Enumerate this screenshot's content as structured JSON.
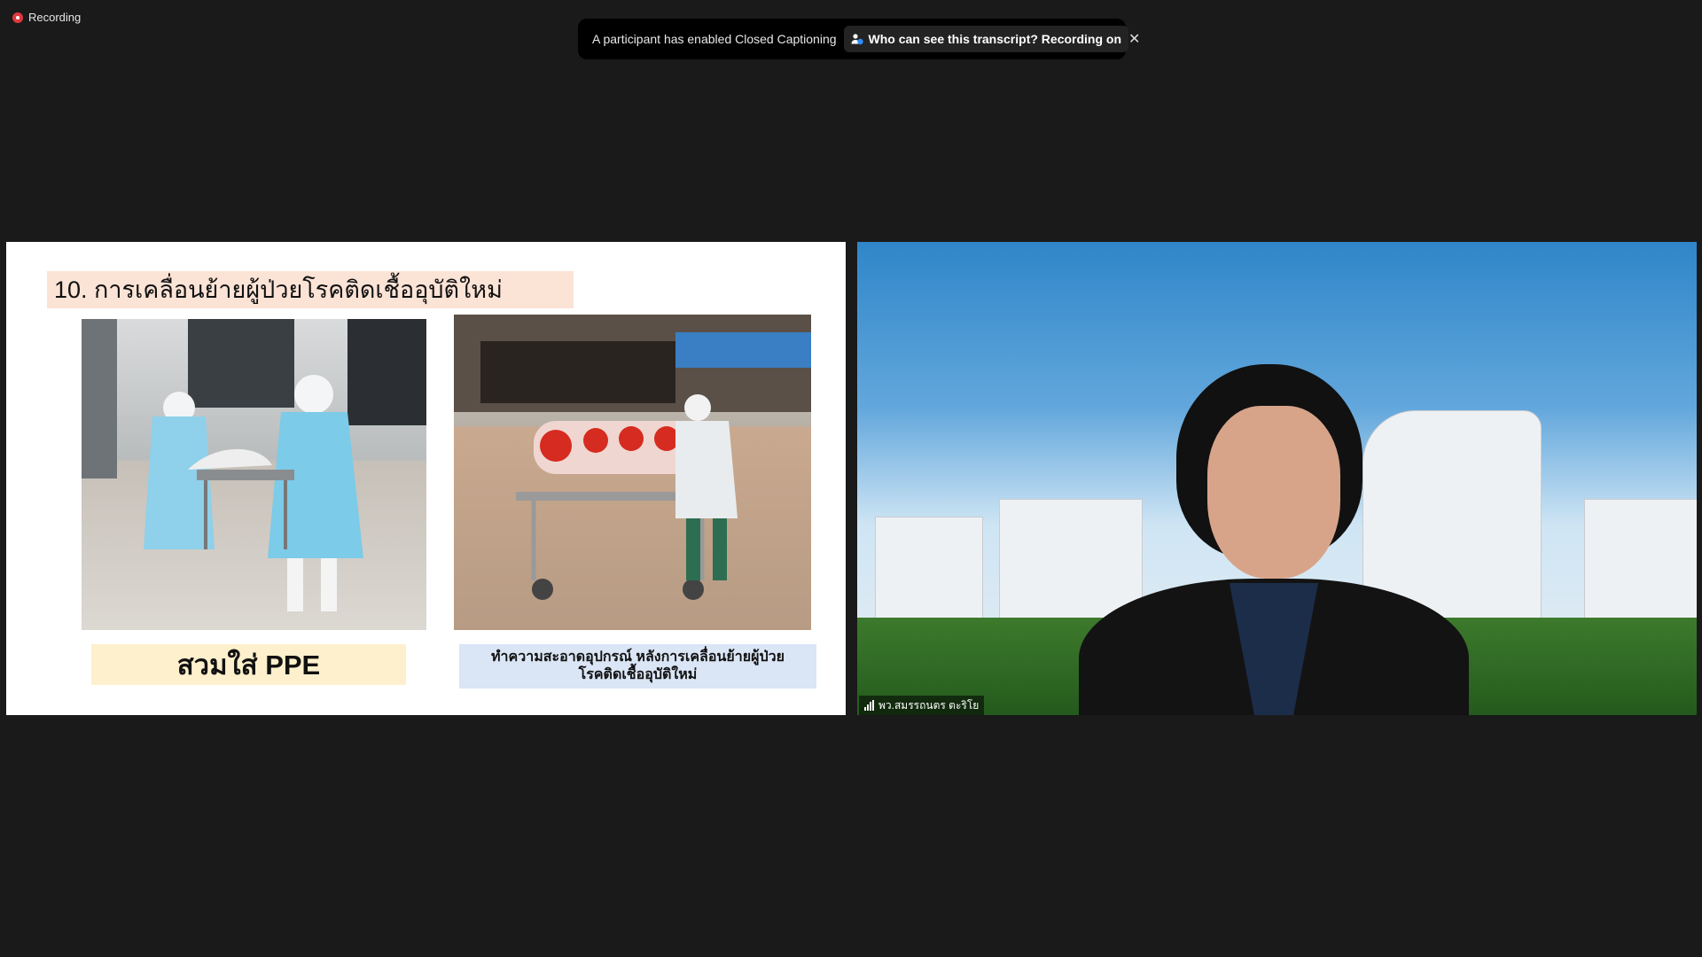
{
  "recording": {
    "label": "Recording"
  },
  "notification": {
    "message": "A participant has enabled Closed Captioning",
    "link_label": "Who can see this transcript? Recording on",
    "close_glyph": "✕"
  },
  "shared_screen": {
    "slide_title": "10. การเคลื่อนย้ายผู้ป่วยโรคติดเชื้ออุบัติใหม่",
    "caption_left": "สวมใส่ PPE",
    "caption_right_line1": "ทำความสะอาดอุปกรณ์ หลังการเคลื่อนย้ายผู้ป่วย",
    "caption_right_line2": "โรคติดเชื้ออุบัติใหม่"
  },
  "participant": {
    "name": "พว.สมรรถนตร ตะริโย"
  },
  "colors": {
    "background": "#1a1a1a",
    "recording_red": "#e0383e",
    "title_fill": "#fbe3d6",
    "caption_left_fill": "#fef0cc",
    "caption_right_fill": "#dae5f5"
  }
}
